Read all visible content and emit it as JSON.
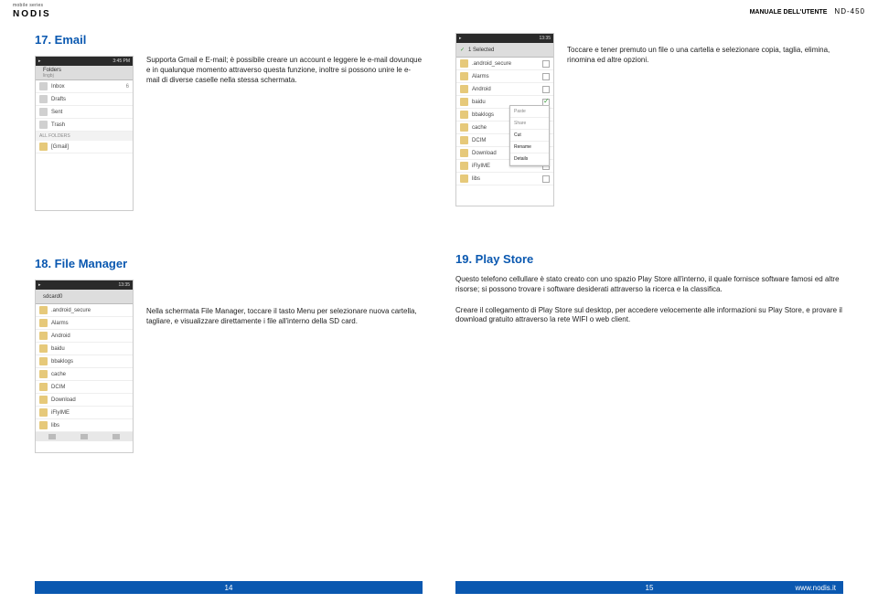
{
  "brand": {
    "sub": "mobile series",
    "main": "NODIS"
  },
  "header": {
    "manual": "MANUALE DELL'UTENTE",
    "model": "ND-450"
  },
  "s17": {
    "title": "17. Email",
    "body": "Supporta Gmail e E-mail; è possibile creare un account e leggere le e-mail dovunque e in qualunque momento attraverso questa funzione, inoltre si possono unire le e-mail di diverse caselle nella stessa schermata.",
    "shot": {
      "time": "3:45 PM",
      "hdr": "Folders",
      "hdr2": "lingbj",
      "items": [
        {
          "label": "Inbox",
          "count": "6"
        },
        {
          "label": "Drafts",
          "count": ""
        },
        {
          "label": "Sent",
          "count": ""
        },
        {
          "label": "Trash",
          "count": ""
        }
      ],
      "sub1": "ALL FOLDERS",
      "sub2": "[Gmail]"
    }
  },
  "s18": {
    "title": "18. File Manager",
    "body": "Nella schermata File Manager, toccare il tasto Menu per selezionare nuova cartella, tagliare, e visualizzare direttamente i file all'interno della SD card.",
    "shot": {
      "time": "13:35",
      "hdr": "sdcard0",
      "items": [
        ".android_secure",
        "Alarms",
        "Android",
        "baidu",
        "bbaklogs",
        "cache",
        "DCIM",
        "Download",
        "iFlyIME",
        "libs"
      ]
    }
  },
  "s19": {
    "title": "19. Play Store",
    "p1": "Toccare e tener premuto un file o una cartella e selezionare copia, taglia, elimina, rinomina ed altre opzioni.",
    "p2": "Questo telefono cellullare è stato creato con uno spazio Play Store all'interno, il quale fornisce software famosi ed altre risorse; si possono trovare i software desiderati attraverso la ricerca e la classifica.",
    "p3": "Creare il collegamento di Play Store sul desktop, per accedere velocemente alle informazioni su Play Store, e provare il download gratuito attraverso la rete WIFI o web client.",
    "shot": {
      "time": "13:35",
      "hdr": "1 Selected",
      "items": [
        {
          "label": ".android_secure",
          "chk": false
        },
        {
          "label": "Alarms",
          "chk": false
        },
        {
          "label": "Android",
          "chk": false
        },
        {
          "label": "baidu",
          "chk": true
        },
        {
          "label": "bbaklogs",
          "chk": false
        },
        {
          "label": "cache",
          "chk": false
        },
        {
          "label": "DCIM",
          "chk": false
        },
        {
          "label": "Download",
          "chk": false
        },
        {
          "label": "iFlyIME",
          "chk": false
        },
        {
          "label": "libs",
          "chk": false
        }
      ],
      "menu": [
        {
          "t": "Paste",
          "a": false
        },
        {
          "t": "Share",
          "a": false
        },
        {
          "t": "Cut",
          "a": true
        },
        {
          "t": "Rename",
          "a": true
        },
        {
          "t": "Details",
          "a": true
        }
      ]
    }
  },
  "footer": {
    "left": "14",
    "right": "15",
    "url": "www.nodis.it"
  }
}
